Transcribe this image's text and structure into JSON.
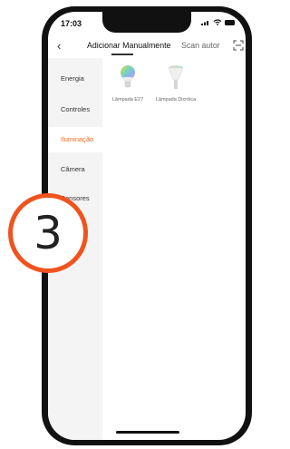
{
  "status_bar": {
    "time": "17:03"
  },
  "header": {
    "back_icon": "chevron-left-icon",
    "active_tab": "Adicionar Manualmente",
    "scan_tab": "Scan autor",
    "scan_icon": "scan-icon"
  },
  "sidebar": {
    "items": [
      {
        "label": "Energia",
        "active": false
      },
      {
        "label": "Controles",
        "active": false
      },
      {
        "label": "Iluminação",
        "active": true
      },
      {
        "label": "Câmera",
        "active": false
      },
      {
        "label": "Sensores",
        "active": false
      }
    ]
  },
  "devices": [
    {
      "label": "Lâmpada E27",
      "icon": "bulb-e27-icon"
    },
    {
      "label": "Lâmpada Dicróica",
      "icon": "bulb-dichroic-icon"
    }
  ],
  "badge": {
    "number": "3"
  },
  "colors": {
    "accent": "#f26b1d",
    "badge_ring": "#f0541e",
    "phone_frame": "#111111"
  }
}
